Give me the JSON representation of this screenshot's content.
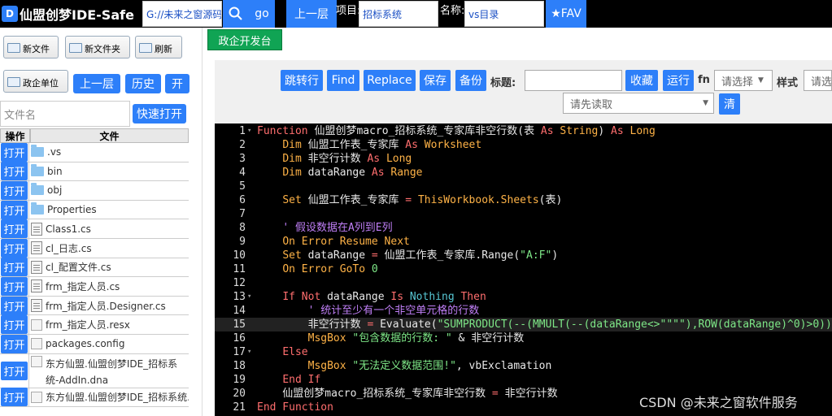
{
  "app": {
    "title": "仙盟创梦IDE-Safe",
    "logo_glyph": "D"
  },
  "topbar": {
    "path_value": "G://未来之窗源码",
    "go_label": "go",
    "up_label": "上一层",
    "project_label": "项目:",
    "project_value": "招标系统",
    "name_label": "名称:",
    "name_value": "vs目录",
    "fav_label": "★FAV"
  },
  "left": {
    "buttons": {
      "new_file": "新文件",
      "new_folder": "新文件夹",
      "refresh": "刷新",
      "org_unit": "政企单位",
      "up": "上一层",
      "history": "历史",
      "open": "开"
    },
    "filename_placeholder": "文件名",
    "quick_open": "快速打开",
    "table_headers": {
      "op": "操作",
      "file": "文件"
    },
    "open_label": "打开",
    "files": [
      {
        "name": ".vs",
        "icon": "folder-icon"
      },
      {
        "name": "bin",
        "icon": "folder-icon"
      },
      {
        "name": "obj",
        "icon": "folder-icon"
      },
      {
        "name": "Properties",
        "icon": "folder-icon"
      },
      {
        "name": "Class1.cs",
        "icon": "file-icon"
      },
      {
        "name": "cl_日志.cs",
        "icon": "file-icon"
      },
      {
        "name": "cl_配置文件.cs",
        "icon": "file-icon"
      },
      {
        "name": "frm_指定人员.cs",
        "icon": "file-icon"
      },
      {
        "name": "frm_指定人员.Designer.cs",
        "icon": "file-icon"
      },
      {
        "name": "frm_指定人员.resx",
        "icon": "image-icon"
      },
      {
        "name": "packages.config",
        "icon": "image-icon"
      },
      {
        "name": "东方仙盟.仙盟创梦IDE_招标系统-AddIn.dna",
        "icon": "image-icon"
      },
      {
        "name": "东方仙盟.仙盟创梦IDE_招标系统.csproj",
        "icon": "image-icon"
      }
    ]
  },
  "tabs": {
    "active": "政企开发台"
  },
  "toolbar": {
    "goto_line": "跳转行",
    "find": "Find",
    "replace": "Replace",
    "save": "保存",
    "backup": "备份",
    "title_label": "标题:",
    "favorite": "收藏",
    "run": "运行",
    "fn_label": "fn",
    "select_placeholder": "请选择",
    "style_label": "样式",
    "style_placeholder": "请选",
    "read_placeholder": "请先读取",
    "clear": "清"
  },
  "editor": {
    "line_numbers": [
      "1",
      "2",
      "3",
      "4",
      "5",
      "6",
      "7",
      "8",
      "9",
      "10",
      "11",
      "12",
      "13",
      "14",
      "15",
      "16",
      "17",
      "18",
      "19",
      "20",
      "21"
    ]
  },
  "watermark": "CSDN @未来之窗软件服务"
}
